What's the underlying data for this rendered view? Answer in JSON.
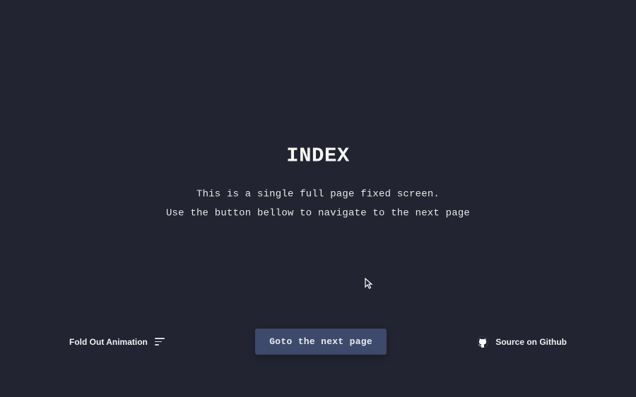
{
  "main": {
    "title": "INDEX",
    "line1": "This is a single full page fixed screen.",
    "line2": "Use the button bellow to navigate to the next page"
  },
  "footer": {
    "left_label": "Fold Out Animation",
    "cta_label": "Goto the next page",
    "right_label": "Source on Github"
  },
  "icons": {
    "menu": "menu-icon",
    "github": "github-icon"
  },
  "colors": {
    "background": "#222431",
    "text": "#f0f0f0",
    "button_bg": "#3e4a6b"
  }
}
